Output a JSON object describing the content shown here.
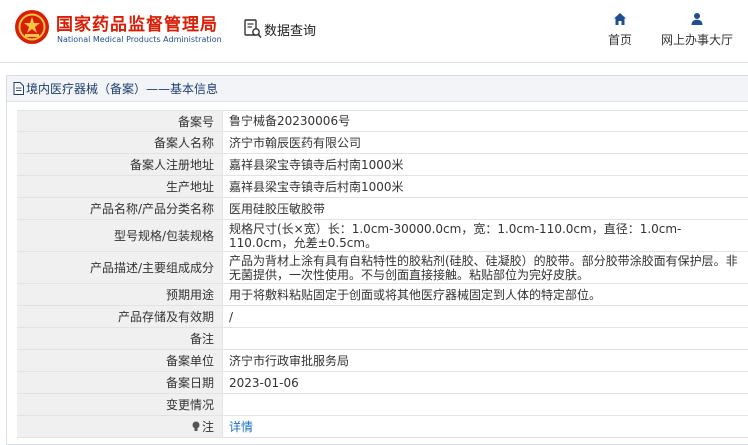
{
  "header": {
    "brand_cn": "国家药品监督管理局",
    "brand_en": "National Medical Products Administration",
    "query_label": "数据查询",
    "nav": [
      {
        "label": "首页",
        "icon": "home-icon"
      },
      {
        "label": "网上办事大厅",
        "icon": "user-icon"
      }
    ]
  },
  "panel": {
    "title": "境内医疗器械（备案）——基本信息"
  },
  "details": [
    {
      "label": "备案号",
      "value": "鲁宁械备20230006号"
    },
    {
      "label": "备案人名称",
      "value": "济宁市翰辰医药有限公司"
    },
    {
      "label": "备案人注册地址",
      "value": "嘉祥县梁宝寺镇寺后村南1000米"
    },
    {
      "label": "生产地址",
      "value": "嘉祥县梁宝寺镇寺后村南1000米"
    },
    {
      "label": "产品名称/产品分类名称",
      "value": "医用硅胶压敏胶带"
    },
    {
      "label": "型号规格/包装规格",
      "value": "规格尺寸(长×宽）长：1.0cm-30000.0cm，宽：1.0cm-110.0cm，直径：1.0cm-110.0cm，允差±0.5cm。"
    },
    {
      "label": "产品描述/主要组成成分",
      "value": "产品为背材上涂有具有自粘特性的胶粘剂(硅胶、硅凝胶）的胶带。部分胶带涂胶面有保护层。非无菌提供，一次性使用。不与创面直接接触。粘贴部位为完好皮肤。"
    },
    {
      "label": "预期用途",
      "value": "用于将敷料粘贴固定于创面或将其他医疗器械固定到人体的特定部位。"
    },
    {
      "label": "产品存储及有效期",
      "value": "/"
    },
    {
      "label": "备注",
      "value": ""
    },
    {
      "label": "备案单位",
      "value": "济宁市行政审批服务局"
    },
    {
      "label": "备案日期",
      "value": "2023-01-06"
    },
    {
      "label": "变更情况",
      "value": ""
    },
    {
      "label": "注",
      "value": "详情"
    }
  ],
  "colors": {
    "brand_red": "#d81e06",
    "label_bg": "#f0f0f0",
    "link_blue": "#1e6fc5"
  }
}
